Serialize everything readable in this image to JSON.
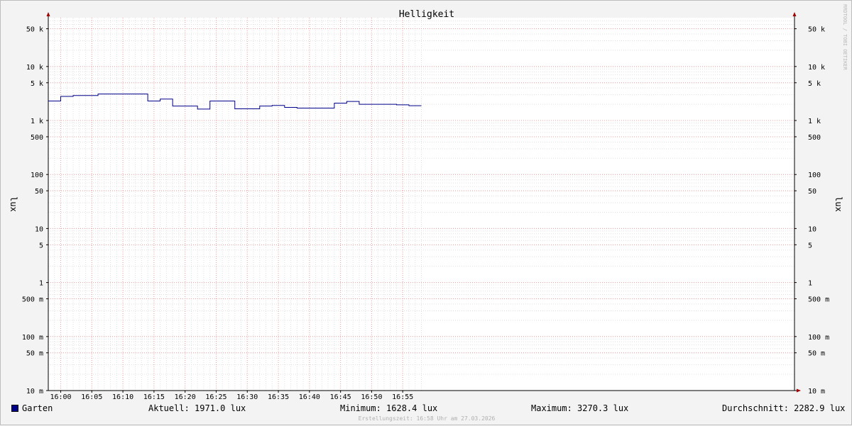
{
  "chart_data": {
    "type": "line",
    "title": "Helligkeit",
    "ylabel": "lux",
    "y_scale": "log",
    "ylim": [
      0.01,
      80000
    ],
    "xlim": [
      "15:58",
      "17:58"
    ],
    "x_ticks": [
      "16:00",
      "16:05",
      "16:10",
      "16:15",
      "16:20",
      "16:25",
      "16:30",
      "16:35",
      "16:40",
      "16:45",
      "16:50",
      "16:55"
    ],
    "y_ticks": [
      {
        "value": 50000,
        "label": "50 k"
      },
      {
        "value": 10000,
        "label": "10 k"
      },
      {
        "value": 5000,
        "label": "5 k"
      },
      {
        "value": 1000,
        "label": "1 k"
      },
      {
        "value": 500,
        "label": "500"
      },
      {
        "value": 100,
        "label": "100"
      },
      {
        "value": 50,
        "label": "50"
      },
      {
        "value": 10,
        "label": "10"
      },
      {
        "value": 5,
        "label": "5"
      },
      {
        "value": 1,
        "label": "1"
      },
      {
        "value": 0.5,
        "label": "500 m"
      },
      {
        "value": 0.1,
        "label": "100 m"
      },
      {
        "value": 0.05,
        "label": "50 m"
      },
      {
        "value": 0.01,
        "label": "10 m"
      }
    ],
    "grid": true,
    "legend_position": "bottom-left",
    "series": [
      {
        "name": "Garten",
        "color": "#00008b",
        "step": true,
        "points": [
          {
            "x": "15:58",
            "y": 2300
          },
          {
            "x": "16:00",
            "y": 2800
          },
          {
            "x": "16:02",
            "y": 2900
          },
          {
            "x": "16:06",
            "y": 3100
          },
          {
            "x": "16:14",
            "y": 2300
          },
          {
            "x": "16:16",
            "y": 2500
          },
          {
            "x": "16:18",
            "y": 1850
          },
          {
            "x": "16:22",
            "y": 1628.4
          },
          {
            "x": "16:24",
            "y": 2300
          },
          {
            "x": "16:28",
            "y": 1650
          },
          {
            "x": "16:32",
            "y": 1850
          },
          {
            "x": "16:34",
            "y": 1900
          },
          {
            "x": "16:36",
            "y": 1750
          },
          {
            "x": "16:38",
            "y": 1700
          },
          {
            "x": "16:44",
            "y": 2100
          },
          {
            "x": "16:46",
            "y": 2250
          },
          {
            "x": "16:48",
            "y": 2000
          },
          {
            "x": "16:54",
            "y": 1950
          },
          {
            "x": "16:56",
            "y": 1880
          },
          {
            "x": "16:58",
            "y": 1880
          }
        ]
      }
    ]
  },
  "watermark": "RRDTOOL / TOBI OETIKER",
  "legend": {
    "series_name": "Garten",
    "swatch_color": "#00008b",
    "current": "Aktuell: 1971.0 lux",
    "minimum": "Minimum: 1628.4 lux",
    "maximum": "Maximum: 3270.3 lux",
    "average": "Durchschnitt: 2282.9 lux"
  },
  "footer": "Erstellungszeit: 16:58 Uhr am 27.03.2026"
}
